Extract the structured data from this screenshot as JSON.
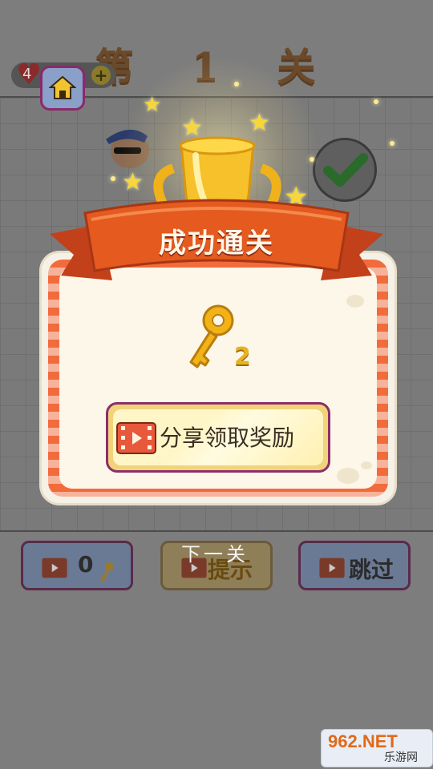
{
  "header": {
    "level_title": "第 1 关",
    "lives": "4",
    "add_label": "+"
  },
  "dialog": {
    "banner": "成功通关",
    "reward_count": "2",
    "share_button": "分享领取奖励"
  },
  "bottom_bar": {
    "keys_count": "0",
    "hint_label": "提示",
    "next_label": "下一关",
    "skip_label": "跳过"
  },
  "watermark": {
    "top": "962.NET",
    "bottom": "乐游网"
  },
  "colors": {
    "ribbon": "#e45a1f",
    "panel_stripe": "#f26b3c",
    "gold": "#f2b319",
    "button_border": "#8a2f6a"
  },
  "icons": [
    "home-icon",
    "heart-icon",
    "plus-icon",
    "check-icon",
    "trophy-icon",
    "key-icon",
    "video-icon",
    "star-icon"
  ]
}
